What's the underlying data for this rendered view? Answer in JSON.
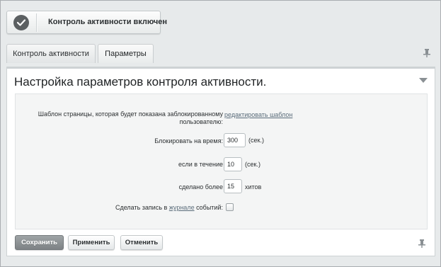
{
  "status": {
    "text": "Контроль активности включен",
    "icon": "check-circle-icon"
  },
  "tabs": [
    {
      "label": "Контроль активности"
    },
    {
      "label": "Параметры"
    }
  ],
  "panel": {
    "title": "Настройка параметров контроля активности.",
    "template_label": "Шаблон страницы, которая будет показана заблокированному пользователю:",
    "template_link": "редактировать шаблон",
    "block_label": "Блокировать на время:",
    "block_value": "300",
    "block_unit": "(сек.)",
    "period_label": "если в течение",
    "period_value": "10",
    "period_unit": "(сек.)",
    "hits_label": "сделано более",
    "hits_value": "15",
    "hits_unit": "хитов",
    "log_label_pre": "Сделать запись в ",
    "log_label_link": "журнале",
    "log_label_post": " событий:",
    "log_checked": false
  },
  "buttons": {
    "save": "Сохранить",
    "apply": "Применить",
    "cancel": "Отменить"
  }
}
